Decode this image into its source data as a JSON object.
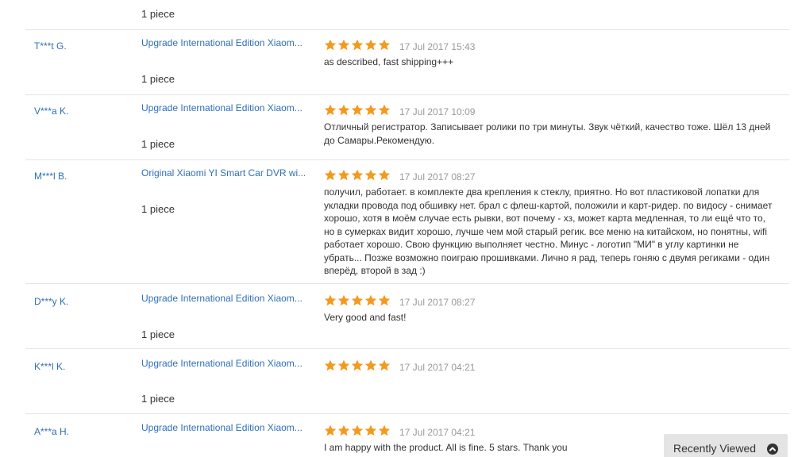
{
  "top_partial": {
    "qty": "1 piece"
  },
  "reviews": [
    {
      "buyer": "T***t G.",
      "product": "Upgrade International Edition Xiaom...",
      "qty": "1 piece",
      "rating": 5,
      "date": "17 Jul 2017 15:43",
      "text": "as described, fast shipping+++"
    },
    {
      "buyer": "V***a K.",
      "product": "Upgrade International Edition Xiaom...",
      "qty": "1 piece",
      "rating": 5,
      "date": "17 Jul 2017 10:09",
      "text": "Отличный регистратор. Записывает ролики по три минуты. Звук чёткий, качество тоже. Шёл 13 дней до Самары.Рекомендую."
    },
    {
      "buyer": "M***l B.",
      "product": "Original Xiaomi YI Smart Car DVR wi...",
      "qty": "1 piece",
      "rating": 5,
      "date": "17 Jul 2017 08:27",
      "text": "получил, работает. в комплекте два крепления к стеклу, приятно. Но вот пластиковой лопатки для укладки провода под обшивку нет. брал с флеш-картой, положили и карт-ридер. по видосу - снимает хорошо, хотя в моём случае есть рывки, вот почему - хз, может карта медленная, то ли ещё что то, но в сумерках видит хорошо, лучше чем мой старый регик. все меню на китайском, но понятны, wifi работает хорошо. Свою функцию выполняет честно. Минус - логотип \"МИ\" в углу картинки не убрать... Позже возможно поиграю прошивками. Лично я рад, теперь гоняю с двумя региками - один вперёд, второй в зад :)"
    },
    {
      "buyer": "D***y K.",
      "product": "Upgrade International Edition Xiaom...",
      "qty": "1 piece",
      "rating": 5,
      "date": "17 Jul 2017 08:27",
      "text": "Very good and fast!"
    },
    {
      "buyer": "K***l K.",
      "product": "Upgrade International Edition Xiaom...",
      "qty": "1 piece",
      "rating": 5,
      "date": "17 Jul 2017 04:21",
      "text": ""
    },
    {
      "buyer": "A***a H.",
      "product": "Upgrade International Edition Xiaom...",
      "qty": "",
      "rating": 5,
      "date": "17 Jul 2017 04:21",
      "text": "I am happy with the product. All is fine. 5 stars. Thank you"
    }
  ],
  "recently_viewed": {
    "label": "Recently Viewed",
    "icon": "chevron-up-circle-icon"
  },
  "colors": {
    "link": "#2f6fb6",
    "star": "#f39a1e",
    "date": "#999999",
    "divider": "#e3e3e3"
  }
}
